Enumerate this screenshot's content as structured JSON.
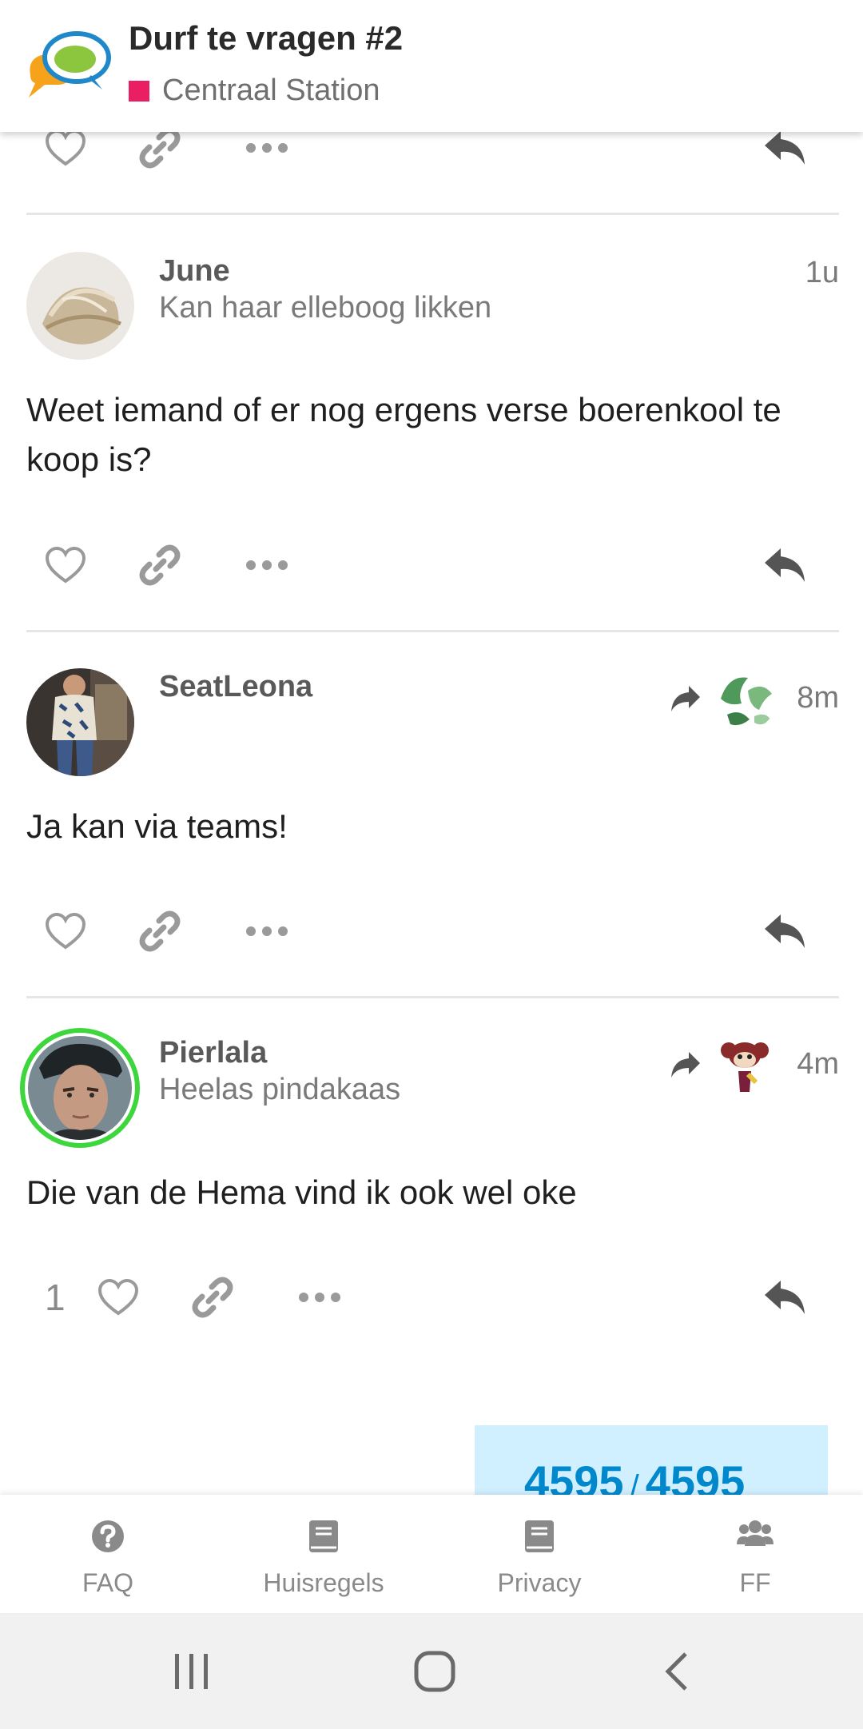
{
  "header": {
    "topic_title": "Durf te vragen #2",
    "category": "Centraal Station",
    "category_color": "#e91e63"
  },
  "posts": [
    {
      "username": "June",
      "user_title": "Kan haar elleboog likken",
      "time": "1u",
      "body": "Weet iemand of er nog ergens verse boerenkool te koop is?"
    },
    {
      "username": "SeatLeona",
      "user_title": "",
      "time": "8m",
      "body": "Ja kan via teams!",
      "reply_to_avatar": "leaf-avatar"
    },
    {
      "username": "Pierlala",
      "user_title": "Heelas pindakaas",
      "time": "4m",
      "body": "Die van de Hema vind ik ook wel oke",
      "like_count": "1",
      "reply_to_avatar": "monkey-avatar",
      "online_ring_color": "#3dd63d"
    }
  ],
  "progress": {
    "current": "4595",
    "separator": "/",
    "total": "4595"
  },
  "footer_nav": [
    {
      "label": "FAQ",
      "icon": "question-circle-icon"
    },
    {
      "label": "Huisregels",
      "icon": "book-icon"
    },
    {
      "label": "Privacy",
      "icon": "book-icon"
    },
    {
      "label": "FF",
      "icon": "users-icon"
    }
  ],
  "colors": {
    "accent": "#0088cc",
    "progress_bg": "#d1f0ff",
    "icon_gray": "#999999"
  }
}
